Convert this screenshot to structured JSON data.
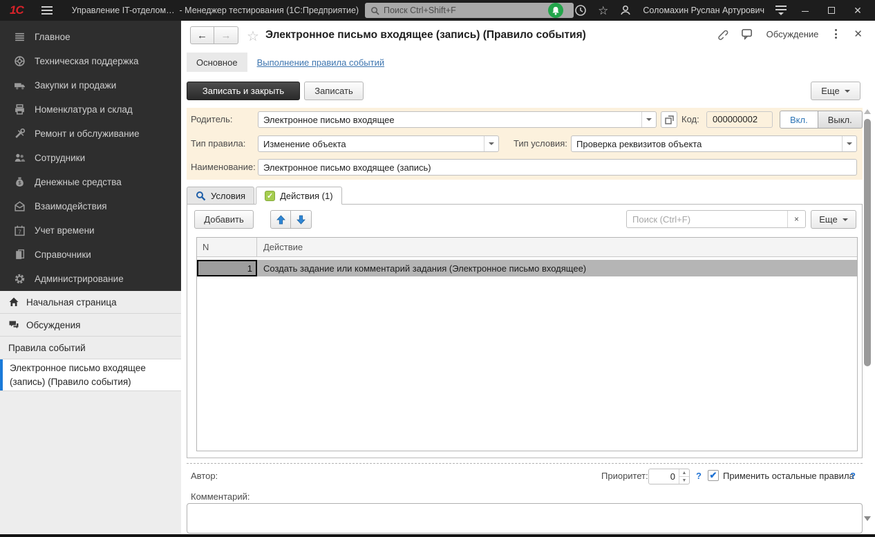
{
  "titlebar": {
    "logo": "1С",
    "app_title": "Управление IT-отделом…",
    "window_title": "- Менеджер тестирования (1С:Предприятие)",
    "search_placeholder": "Поиск Ctrl+Shift+F",
    "user_name": "Соломахин Руслан Артурович"
  },
  "sidebar": {
    "dark_items": [
      {
        "label": "Главное",
        "icon": "menu-lines-icon"
      },
      {
        "label": "Техническая поддержка",
        "icon": "lifebuoy-icon"
      },
      {
        "label": "Закупки и продажи",
        "icon": "truck-icon"
      },
      {
        "label": "Номенклатура и склад",
        "icon": "printer-icon"
      },
      {
        "label": "Ремонт и обслуживание",
        "icon": "tools-icon"
      },
      {
        "label": "Сотрудники",
        "icon": "people-icon"
      },
      {
        "label": "Денежные средства",
        "icon": "money-bag-icon"
      },
      {
        "label": "Взаимодействия",
        "icon": "envelope-icon"
      },
      {
        "label": "Учет времени",
        "icon": "calendar-icon"
      },
      {
        "label": "Справочники",
        "icon": "books-icon"
      },
      {
        "label": "Администрирование",
        "icon": "gear-icon"
      }
    ],
    "home_item": "Начальная страница",
    "discussions_item": "Обсуждения",
    "open_windows": [
      "Правила событий",
      "Электронное письмо входящее (запись) (Правило события)"
    ]
  },
  "header": {
    "title": "Электронное письмо входящее (запись) (Правило события)",
    "nav_tab": "Основное",
    "nav_link": "Выполнение правила событий",
    "discussion_label": "Обсуждение"
  },
  "commands": {
    "save_close": "Записать и закрыть",
    "save": "Записать",
    "more": "Еще"
  },
  "form": {
    "parent": {
      "label": "Родитель:",
      "value": "Электронное письмо входящее"
    },
    "code": {
      "label": "Код:",
      "value": "000000002"
    },
    "toggle_on": "Вкл.",
    "toggle_off": "Выкл.",
    "rule_type": {
      "label": "Тип правила:",
      "value": "Изменение объекта"
    },
    "condition_type": {
      "label": "Тип условия:",
      "value": "Проверка реквизитов объекта"
    },
    "name": {
      "label": "Наименование:",
      "value": "Электронное письмо входящее (запись)"
    }
  },
  "tabs": {
    "conditions": "Условия",
    "actions": "Действия (1)"
  },
  "actions_panel": {
    "add": "Добавить",
    "search_placeholder": "Поиск (Ctrl+F)",
    "clear": "×",
    "more": "Еще",
    "table": {
      "columns": [
        "N",
        "Действие"
      ],
      "rows": [
        {
          "n": "1",
          "action": "Создать задание или комментарий задания (Электронное письмо входящее)"
        }
      ]
    }
  },
  "footer": {
    "author_label": "Автор:",
    "priority_label": "Приоритет:",
    "priority_value": "0",
    "help": "?",
    "apply_rest_label": "Применить остальные правила",
    "comment_label": "Комментарий:"
  },
  "colors": {
    "accent_blue": "#1a7ad9",
    "form_background": "#fcf1dd",
    "logo_red": "#d8232a",
    "notification_green": "#23a54b",
    "action_green": "#a5cd50"
  }
}
